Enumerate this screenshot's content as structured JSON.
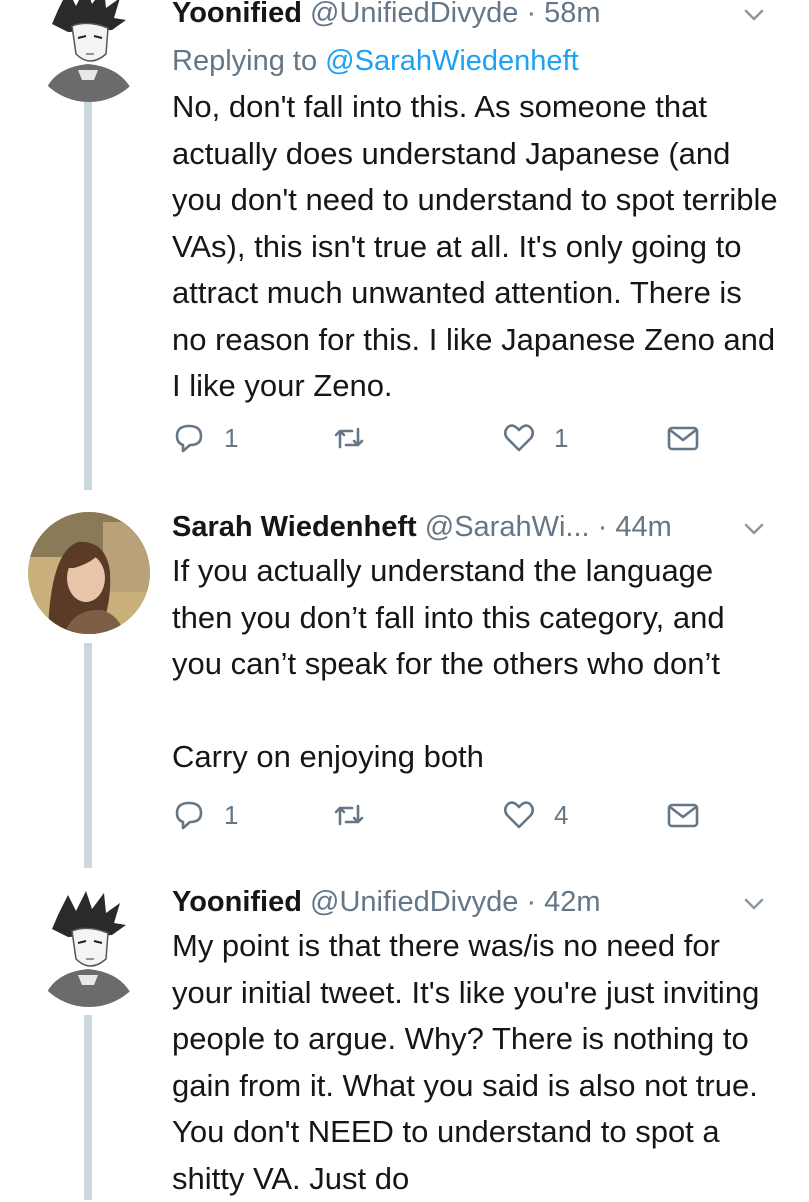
{
  "tweets": [
    {
      "name": "Yoonified",
      "handle": "@UnifiedDivyde",
      "separator": "·",
      "time": "58m",
      "replying_label": "Replying to",
      "replying_to": "@SarahWiedenheft",
      "text": "No, don't fall into this. As someone that actually does understand Japanese (and you don't need to understand to spot terrible VAs), this isn't true at all. It's only going to attract much unwanted attention. There is no reason for this. I like Japanese Zeno and I like your Zeno.",
      "replies": "1",
      "retweets": "",
      "likes": "1",
      "avatar_icon": "anime-character-avatar"
    },
    {
      "name": "Sarah Wiedenheft",
      "handle": "@SarahWi...",
      "separator": "·",
      "time": "44m",
      "text": "If you actually understand the language then you don’t fall into this category, and you can’t speak for the others who don’t\n\nCarry on enjoying both",
      "replies": "1",
      "retweets": "",
      "likes": "4",
      "avatar_icon": "profile-photo-avatar"
    },
    {
      "name": "Yoonified",
      "handle": "@UnifiedDivyde",
      "separator": "·",
      "time": "42m",
      "text": "My point is that there was/is no need for your initial tweet. It's like you're just inviting people to argue. Why? There is nothing to gain from it. What you said is also not true. You don't NEED to understand to spot a shitty VA. Just do",
      "avatar_icon": "anime-character-avatar"
    }
  ],
  "colors": {
    "text": "#14171a",
    "secondary": "#657786",
    "link": "#1da1f2",
    "thread_line": "#ccd6dd"
  },
  "icons": [
    "reply-icon",
    "retweet-icon",
    "like-icon",
    "dm-icon",
    "chevron-down-icon"
  ]
}
